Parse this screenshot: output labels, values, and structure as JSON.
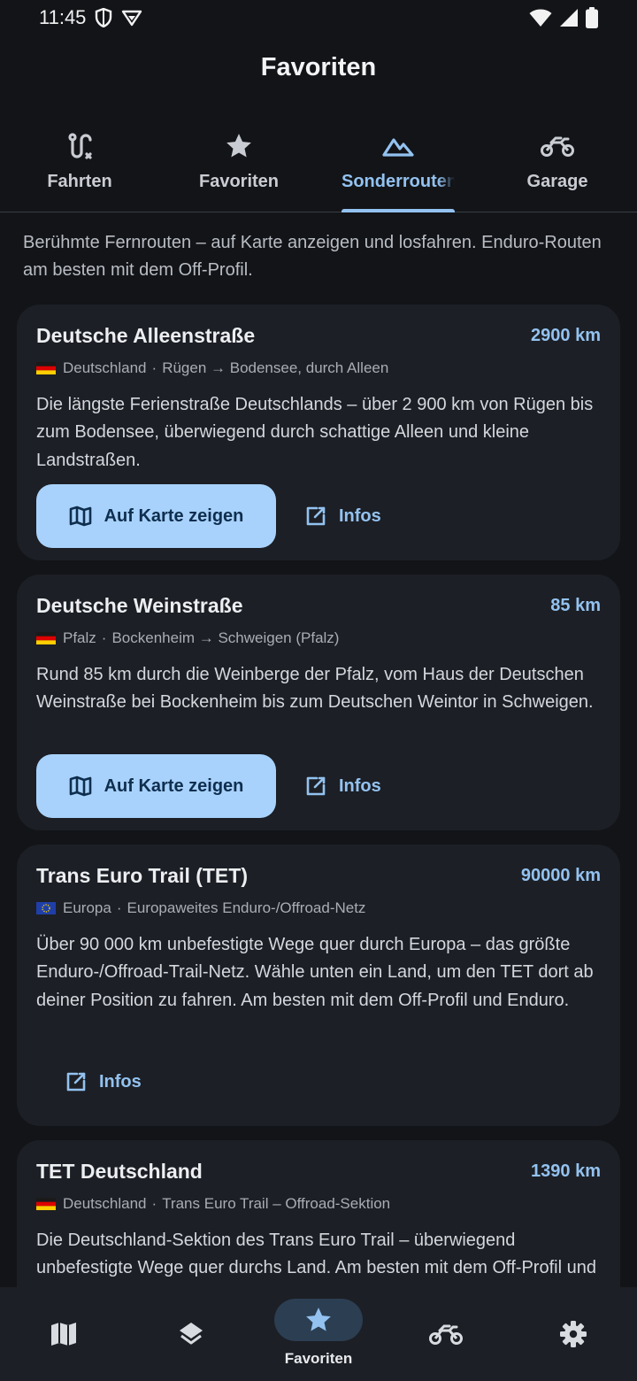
{
  "status": {
    "time": "11:45"
  },
  "app": {
    "title": "Favoriten"
  },
  "tabs": [
    {
      "label": "Fahrten",
      "icon": "route-icon"
    },
    {
      "label": "Favoriten",
      "icon": "star-icon"
    },
    {
      "label": "Sonderrouten",
      "icon": "mountain-icon",
      "active": true
    },
    {
      "label": "Garage",
      "icon": "motorcycle-icon"
    }
  ],
  "intro": "Berühmte Fernrouten – auf Karte anzeigen und losfahren. Enduro-Routen am besten mit dem Off-Profil.",
  "routes": [
    {
      "title": "Deutsche Alleenstraße",
      "km": "2900 km",
      "flag": "de",
      "region": "Deutschland",
      "route": "Rügen → Bodensee, durch Alleen",
      "desc": "Die längste Ferienstraße Deutschlands – über 2 900 km von Rügen bis zum Bodensee, überwiegend durch schattige Alleen und kleine Landstraßen.",
      "map_label": "Auf Karte zeigen",
      "info_label": "Infos"
    },
    {
      "title": "Deutsche Weinstraße",
      "km": "85 km",
      "flag": "de",
      "region": "Pfalz",
      "route": "Bockenheim → Schweigen (Pfalz)",
      "desc": "Rund 85 km durch die Weinberge der Pfalz, vom Haus der Deutschen Weinstraße bei Bockenheim bis zum Deutschen Weintor in Schweigen.",
      "map_label": "Auf Karte zeigen",
      "info_label": "Infos"
    },
    {
      "title": "Trans Euro Trail (TET)",
      "km": "90000 km",
      "flag": "eu",
      "region": "Europa",
      "route": "Europaweites Enduro-/Offroad-Netz",
      "desc": "Über 90 000 km unbefestigte Wege quer durch Europa – das größte Enduro-/Offroad-Trail-Netz. Wähle unten ein Land, um den TET dort ab deiner Position zu fahren. Am besten mit dem Off-Profil und Enduro.",
      "info_label": "Infos"
    },
    {
      "title": "TET Deutschland",
      "km": "1390 km",
      "flag": "de",
      "region": "Deutschland",
      "route": "Trans Euro Trail – Offroad-Sektion",
      "desc": "Die Deutschland-Sektion des Trans Euro Trail – überwiegend unbefestigte Wege quer durchs Land. Am besten mit dem Off-Profil und Enduro."
    }
  ],
  "bottom_nav": [
    {
      "icon": "map-icon"
    },
    {
      "icon": "layers-icon"
    },
    {
      "icon": "star-icon",
      "label": "Favoriten",
      "active": true
    },
    {
      "icon": "motorcycle-icon"
    },
    {
      "icon": "settings-icon"
    }
  ],
  "colors": {
    "accent": "#93c2f0",
    "button": "#a8d2fb",
    "card": "#1c1f25",
    "background": "#121418"
  }
}
